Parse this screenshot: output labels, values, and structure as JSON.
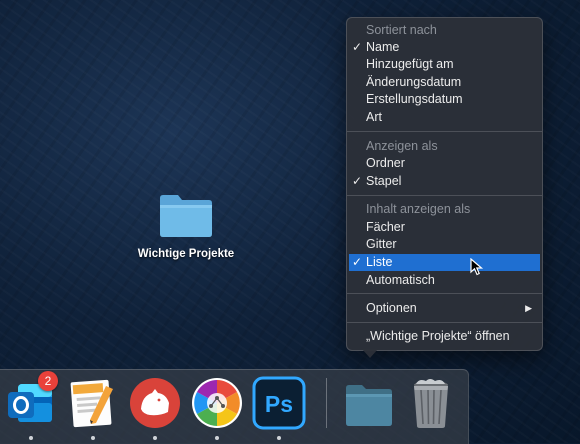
{
  "desktop": {
    "folder_label": "Wichtige Projekte"
  },
  "context_menu": {
    "sort_header": "Sortiert nach",
    "sort_options": [
      "Name",
      "Hinzugefügt am",
      "Änderungsdatum",
      "Erstellungsdatum",
      "Art"
    ],
    "sort_selected": "Name",
    "view_header": "Anzeigen als",
    "view_options": [
      "Ordner",
      "Stapel"
    ],
    "view_selected": "Stapel",
    "content_header": "Inhalt anzeigen als",
    "content_options": [
      "Fächer",
      "Gitter",
      "Liste",
      "Automatisch"
    ],
    "content_selected": "Liste",
    "highlighted_item": "Liste",
    "options_label": "Optionen",
    "open_label": "„Wichtige Projekte“ öffnen",
    "checkmark": "✓",
    "submenu_arrow": "▶"
  },
  "dock": {
    "items": [
      {
        "app": "Outlook",
        "icon": "outlook-icon",
        "badge": "2"
      },
      {
        "app": "Pages",
        "icon": "pages-icon"
      },
      {
        "app": "Bear",
        "icon": "bear-icon"
      },
      {
        "app": "Affinity",
        "icon": "affinity-icon"
      },
      {
        "app": "Photoshop",
        "icon": "photoshop-icon",
        "text": "Ps"
      },
      {
        "app": "Folder Stack",
        "icon": "folder-stack-icon"
      },
      {
        "app": "Trash",
        "icon": "trash-icon"
      }
    ],
    "colors": {
      "outlook": "#0f6cbd",
      "bear": "#d9433a",
      "photoshop_bg": "#0b1f33",
      "photoshop_fg": "#31a8ff",
      "menu_highlight": "#1f6fd1"
    }
  }
}
